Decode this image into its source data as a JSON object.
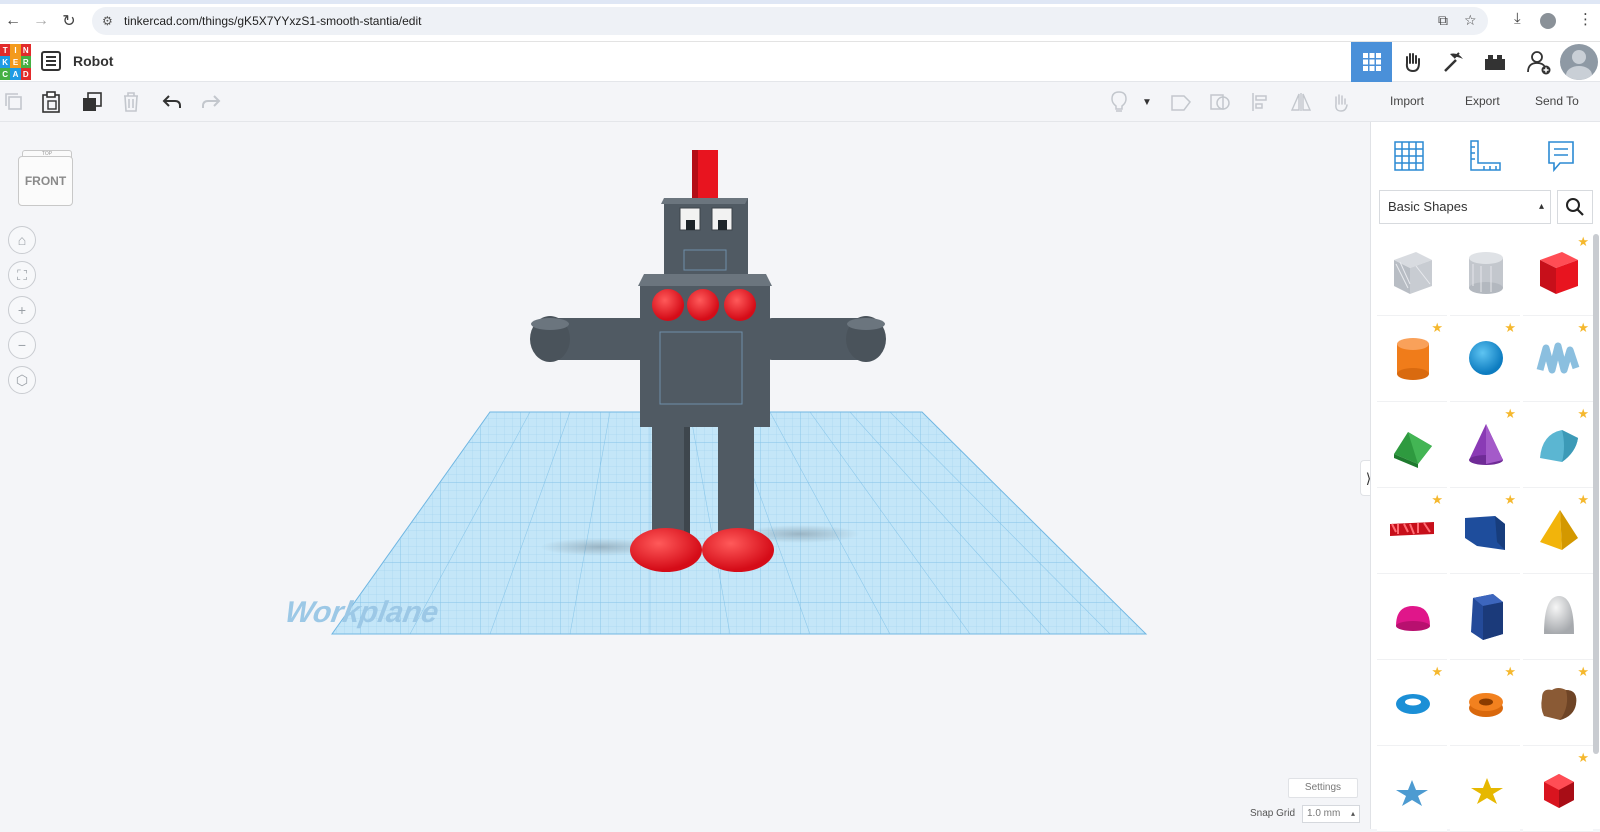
{
  "browser": {
    "url": "tinkercad.com/things/gK5X7YYxzS1-smooth-stantia/edit"
  },
  "header": {
    "logo_letters": [
      "T",
      "I",
      "N",
      "K",
      "E",
      "R",
      "C",
      "A",
      "D"
    ],
    "title": "Robot"
  },
  "actions": {
    "import": "Import",
    "export": "Export",
    "send_to": "Send To"
  },
  "viewcube": {
    "top_label": "TOP",
    "front_label": "FRONT"
  },
  "workplane": {
    "label": "Workplane"
  },
  "bottom": {
    "settings": "Settings",
    "snap_grid_label": "Snap Grid",
    "snap_grid_value": "1.0 mm"
  },
  "panel": {
    "category": "Basic Shapes",
    "shapes": [
      {
        "name": "box-hole",
        "star": false
      },
      {
        "name": "cylinder-hole",
        "star": false
      },
      {
        "name": "box",
        "star": true
      },
      {
        "name": "cylinder",
        "star": true
      },
      {
        "name": "sphere",
        "star": true
      },
      {
        "name": "scribble",
        "star": true
      },
      {
        "name": "roof",
        "star": false
      },
      {
        "name": "cone",
        "star": true
      },
      {
        "name": "round-roof",
        "star": true
      },
      {
        "name": "text",
        "star": true
      },
      {
        "name": "wedge",
        "star": true
      },
      {
        "name": "pyramid",
        "star": true
      },
      {
        "name": "half-sphere",
        "star": false
      },
      {
        "name": "polygon",
        "star": false
      },
      {
        "name": "paraboloid",
        "star": false
      },
      {
        "name": "torus",
        "star": true
      },
      {
        "name": "tube",
        "star": true
      },
      {
        "name": "heart",
        "star": true
      },
      {
        "name": "star",
        "star": false
      },
      {
        "name": "star-gold",
        "star": false
      },
      {
        "name": "icosahedron",
        "star": true
      }
    ]
  },
  "colors": {
    "accent": "#4a90d9",
    "robot_gray": "#505a63",
    "robot_red": "#e8141f",
    "workplane_blue": "#bfe3f7"
  }
}
